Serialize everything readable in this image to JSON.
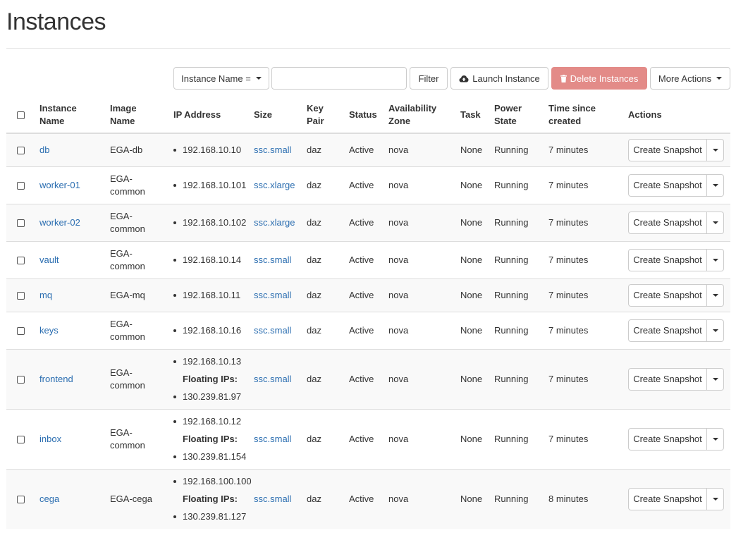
{
  "page": {
    "title": "Instances"
  },
  "toolbar": {
    "filter_select_label": "Instance Name =",
    "filter_input_value": "",
    "filter_button_label": "Filter",
    "launch_button_label": "Launch Instance",
    "delete_button_label": "Delete Instances",
    "more_actions_label": "More Actions",
    "delete_color": "#e38b88"
  },
  "table": {
    "headers": {
      "name": [
        "Instance",
        "Name"
      ],
      "image": [
        "Image",
        "Name"
      ],
      "ip": [
        "IP Address"
      ],
      "size": [
        "Size"
      ],
      "keypair": [
        "Key",
        "Pair"
      ],
      "status": [
        "Status"
      ],
      "az": [
        "Availability",
        "Zone"
      ],
      "task": [
        "Task"
      ],
      "power": [
        "Power",
        "State"
      ],
      "time": [
        "Time since",
        "created"
      ],
      "actions": [
        "Actions"
      ]
    },
    "floating_label": "Floating IPs:",
    "action_label": "Create Snapshot",
    "rows": [
      {
        "name": "db",
        "image": [
          "EGA-db"
        ],
        "ips": [
          "192.168.10.10"
        ],
        "floating": [],
        "size": "ssc.small",
        "keypair": "daz",
        "status": "Active",
        "az": "nova",
        "task": "None",
        "power": "Running",
        "time": "7 minutes",
        "h": 47
      },
      {
        "name": "worker-01",
        "image": [
          "EGA-",
          "common"
        ],
        "ips": [
          "192.168.10.101"
        ],
        "floating": [],
        "size": "ssc.xlarge",
        "keypair": "daz",
        "status": "Active",
        "az": "nova",
        "task": "None",
        "power": "Running",
        "time": "7 minutes",
        "h": 53
      },
      {
        "name": "worker-02",
        "image": [
          "EGA-",
          "common"
        ],
        "ips": [
          "192.168.10.102"
        ],
        "floating": [],
        "size": "ssc.xlarge",
        "keypair": "daz",
        "status": "Active",
        "az": "nova",
        "task": "None",
        "power": "Running",
        "time": "7 minutes",
        "h": 53
      },
      {
        "name": "vault",
        "image": [
          "EGA-",
          "common"
        ],
        "ips": [
          "192.168.10.14"
        ],
        "floating": [],
        "size": "ssc.small",
        "keypair": "daz",
        "status": "Active",
        "az": "nova",
        "task": "None",
        "power": "Running",
        "time": "7 minutes",
        "h": 53
      },
      {
        "name": "mq",
        "image": [
          "EGA-mq"
        ],
        "ips": [
          "192.168.10.11"
        ],
        "floating": [],
        "size": "ssc.small",
        "keypair": "daz",
        "status": "Active",
        "az": "nova",
        "task": "None",
        "power": "Running",
        "time": "7 minutes",
        "h": 47
      },
      {
        "name": "keys",
        "image": [
          "EGA-",
          "common"
        ],
        "ips": [
          "192.168.10.16"
        ],
        "floating": [],
        "size": "ssc.small",
        "keypair": "daz",
        "status": "Active",
        "az": "nova",
        "task": "None",
        "power": "Running",
        "time": "7 minutes",
        "h": 53
      },
      {
        "name": "frontend",
        "image": [
          "EGA-",
          "common"
        ],
        "ips": [
          "192.168.10.13"
        ],
        "floating": [
          "130.239.81.97"
        ],
        "size": "ssc.small",
        "keypair": "daz",
        "status": "Active",
        "az": "nova",
        "task": "None",
        "power": "Running",
        "time": "7 minutes",
        "h": 85
      },
      {
        "name": "inbox",
        "image": [
          "EGA-",
          "common"
        ],
        "ips": [
          "192.168.10.12"
        ],
        "floating": [
          "130.239.81.154"
        ],
        "size": "ssc.small",
        "keypair": "daz",
        "status": "Active",
        "az": "nova",
        "task": "None",
        "power": "Running",
        "time": "7 minutes",
        "h": 85
      },
      {
        "name": "cega",
        "image": [
          "EGA-cega"
        ],
        "ips": [
          "192.168.100.100"
        ],
        "floating": [
          "130.239.81.127"
        ],
        "size": "ssc.small",
        "keypair": "daz",
        "status": "Active",
        "az": "nova",
        "task": "None",
        "power": "Running",
        "time": "8 minutes",
        "h": 85
      }
    ]
  }
}
